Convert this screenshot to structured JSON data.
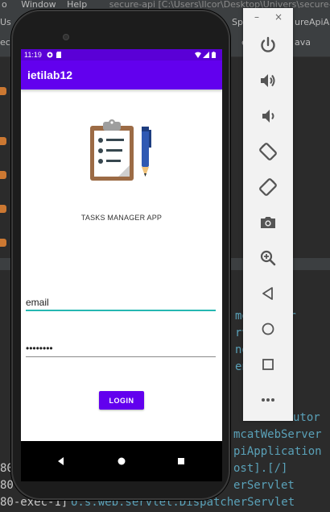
{
  "ide": {
    "menu": [
      "Window",
      "Help"
    ],
    "path_text": "secure-api [C:\\Users\\Ilcor\\Desktop\\Univers\\secure-api]",
    "tab_fragments": [
      "Sp",
      "ureApiA",
      "ava"
    ],
    "console_lines": [
      "merServer",
      "rvice",
      "ngine",
      "ener",
      "utor",
      "mcatWebServer",
      "piApplication",
      "ost].[/]",
      "erServlet",
      "o.s.web.servlet.DispatcherServlet"
    ],
    "console_prefix": [
      "80-",
      "80-",
      "80-exec-1]"
    ]
  },
  "phone": {
    "status_time": "11:19",
    "app_title": "ietilab12",
    "app_name": "TASKS MANAGER APP",
    "email_value": "email",
    "password_value": "••••••••",
    "login_label": "LOGIN"
  },
  "emulator": {
    "minimize": "–",
    "close": "×",
    "buttons": [
      "power-icon",
      "volume-up-icon",
      "volume-down-icon",
      "rotate-left-icon",
      "rotate-right-icon",
      "camera-icon",
      "zoom-icon",
      "back-icon",
      "home-icon",
      "overview-icon",
      "more-icon"
    ]
  },
  "colors": {
    "accent": "#6200ee",
    "status_bar": "#5a00d6",
    "focus_underline": "#26b7b2",
    "console_text": "#5aa1b8"
  }
}
